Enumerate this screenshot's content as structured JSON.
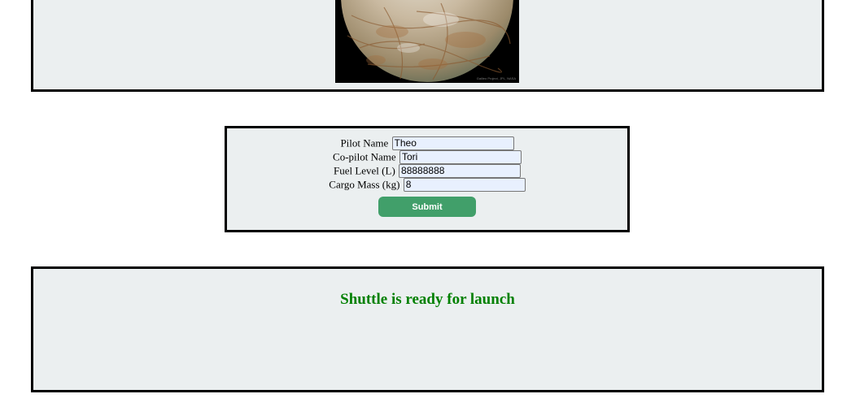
{
  "mission": {
    "image_alt": "planet-europa-photo",
    "image_credit": "Galileo Project, JPL, NASA"
  },
  "form": {
    "pilot_label": "Pilot Name",
    "pilot_value": "Theo",
    "copilot_label": "Co-pilot Name",
    "copilot_value": "Tori",
    "fuel_label": "Fuel Level (L)",
    "fuel_value": "88888888",
    "cargo_label": "Cargo Mass (kg)",
    "cargo_value": "8",
    "submit_label": "Submit"
  },
  "status": {
    "launch_status": "Shuttle is ready for launch",
    "status_color": "#008000"
  },
  "colors": {
    "panel_background": "#ebeff0",
    "button_green": "#419f6a",
    "input_autofill": "#e8f0fe"
  }
}
